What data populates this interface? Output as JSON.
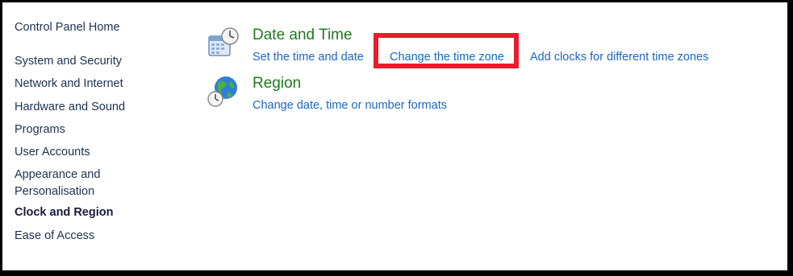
{
  "sidebar": {
    "home": "Control Panel Home",
    "items": [
      {
        "label": "System and Security"
      },
      {
        "label": "Network and Internet"
      },
      {
        "label": "Hardware and Sound"
      },
      {
        "label": "Programs"
      },
      {
        "label": "User Accounts"
      },
      {
        "label": "Appearance and Personalisation"
      },
      {
        "label": "Clock and Region",
        "current": true
      },
      {
        "label": "Ease of Access"
      }
    ]
  },
  "main": {
    "categories": [
      {
        "title": "Date and Time",
        "icon": "calendar-clock-icon",
        "links": [
          "Set the time and date",
          "Change the time zone",
          "Add clocks for different time zones"
        ]
      },
      {
        "title": "Region",
        "icon": "globe-clock-icon",
        "links": [
          "Change date, time or number formats"
        ]
      }
    ],
    "highlighted_link": "Change the time zone",
    "highlight_color": "#e81c2c"
  },
  "colors": {
    "category_title": "#1e7a1e",
    "link": "#1a66c4",
    "sidebar_text": "#1e3050"
  }
}
